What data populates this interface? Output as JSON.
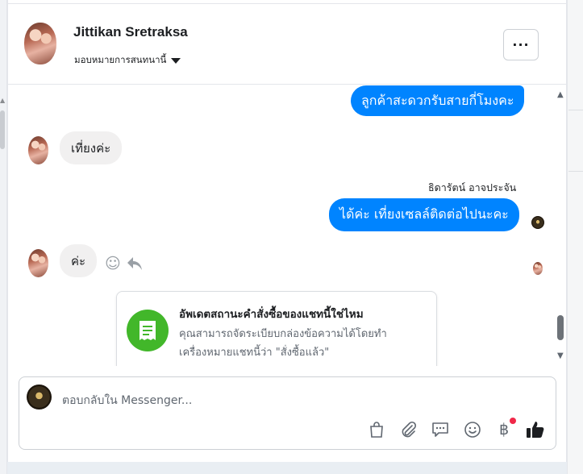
{
  "conversation": {
    "name": "Jittikan Sretraksa",
    "assign_label": "มอบหมายการสนทนานี้",
    "more_label": "···"
  },
  "messages": {
    "m1": "ลูกค้าสะดวกรับสายกี่โมงคะ",
    "m2": "เที่ยงค่ะ",
    "sender": "ธิดารัตน์ อาจประจัน",
    "m3": "ได้ค่ะ เที่ยงเซลล์ติดต่อไปนะคะ",
    "m4": "ค่ะ"
  },
  "suggestion_card": {
    "title": "อัพเดตสถานะคำสั่งซื้อของแชทนี้ใช่ไหม",
    "line1": "คุณสามารถจัดระเบียบกล่องข้อความได้โดยทำ",
    "line2": "เครื่องหมายแชทนี้ว่า \"สั่งซื้อแล้ว\"",
    "icon": "receipt-icon",
    "icon_color": "#42b72a"
  },
  "composer": {
    "placeholder": "ตอบกลับใน Messenger...",
    "tools": [
      "shopping-bag-icon",
      "paperclip-icon",
      "chat-bubble-icon",
      "emoji-icon",
      "baht-icon",
      "thumbs-up-icon"
    ]
  },
  "colors": {
    "outgoing_bubble": "#0084ff",
    "incoming_bubble": "#f1f0f0",
    "notification_dot": "#f02849"
  }
}
